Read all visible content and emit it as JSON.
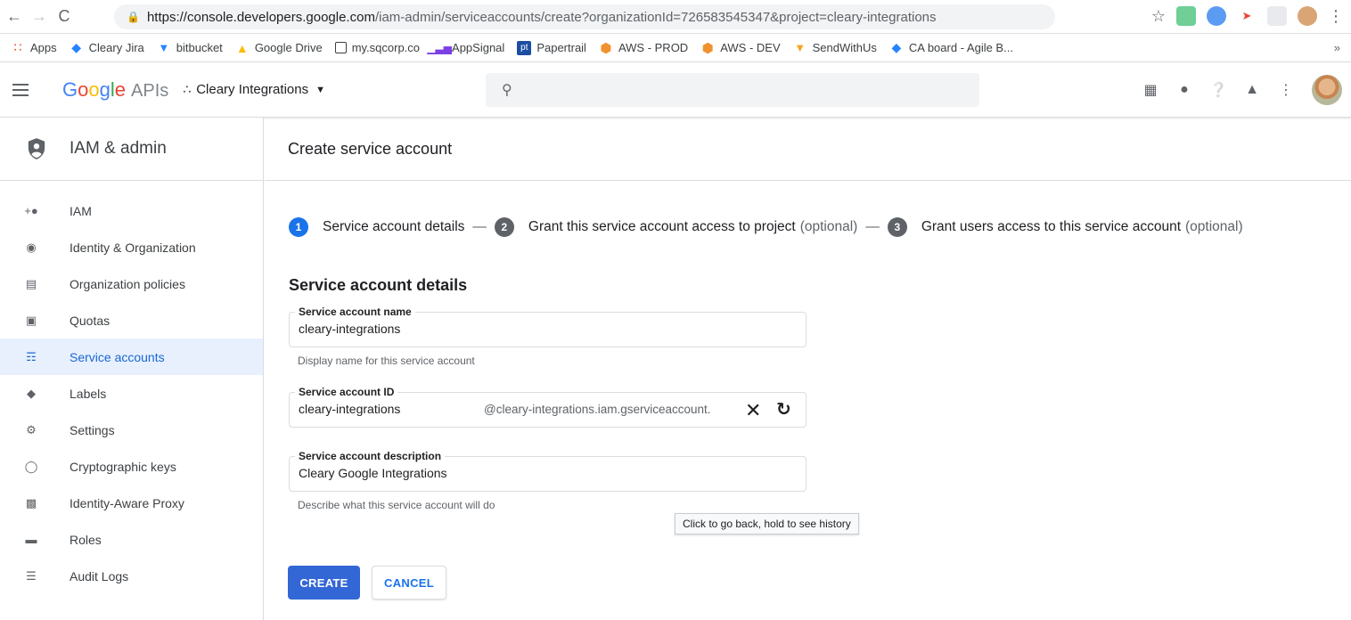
{
  "browser": {
    "url_host": "https://console.developers.google.com",
    "url_path": "/iam-admin/serviceaccounts/create?organizationId=726583545347&project=cleary-integrations",
    "bookmarks": [
      "Apps",
      "Cleary Jira",
      "bitbucket",
      "Google Drive",
      "my.sqcorp.co",
      "AppSignal",
      "Papertrail",
      "AWS - PROD",
      "AWS - DEV",
      "SendWithUs",
      "CA board - Agile B..."
    ],
    "bookmarks_more": "»"
  },
  "header": {
    "logo_letters": [
      "G",
      "o",
      "o",
      "g",
      "l",
      "e"
    ],
    "logo_suffix": "APIs",
    "project_name": "Cleary Integrations"
  },
  "sidebar": {
    "title": "IAM & admin",
    "items": [
      {
        "label": "IAM",
        "icon": "add-person-icon"
      },
      {
        "label": "Identity & Organization",
        "icon": "account-circle-icon"
      },
      {
        "label": "Organization policies",
        "icon": "document-icon"
      },
      {
        "label": "Quotas",
        "icon": "quota-icon"
      },
      {
        "label": "Service accounts",
        "icon": "service-account-icon",
        "active": true
      },
      {
        "label": "Labels",
        "icon": "label-icon"
      },
      {
        "label": "Settings",
        "icon": "gear-icon"
      },
      {
        "label": "Cryptographic keys",
        "icon": "security-icon"
      },
      {
        "label": "Identity-Aware Proxy",
        "icon": "proxy-icon"
      },
      {
        "label": "Roles",
        "icon": "roles-icon"
      },
      {
        "label": "Audit Logs",
        "icon": "list-icon"
      }
    ]
  },
  "main": {
    "page_title": "Create service account",
    "steps": [
      {
        "num": "1",
        "label": "Service account details",
        "optional": ""
      },
      {
        "num": "2",
        "label": "Grant this service account access to project",
        "optional": "(optional)"
      },
      {
        "num": "3",
        "label": "Grant users access to this service account",
        "optional": "(optional)"
      }
    ],
    "step_separator": "—",
    "section_title": "Service account details",
    "fields": {
      "name": {
        "label": "Service account name",
        "value": "cleary-integrations",
        "hint": "Display name for this service account"
      },
      "id": {
        "label": "Service account ID",
        "value": "cleary-integrations",
        "suffix": "@cleary-integrations.iam.gserviceaccount."
      },
      "description": {
        "label": "Service account description",
        "value": "Cleary Google Integrations",
        "hint": "Describe what this service account will do"
      }
    },
    "tooltip": "Click to go back, hold to see history",
    "create_label": "CREATE",
    "cancel_label": "CANCEL"
  },
  "colors": {
    "primary": "#1a73e8",
    "active_bg": "#e8f0fe",
    "create_button": "#3367d6"
  }
}
